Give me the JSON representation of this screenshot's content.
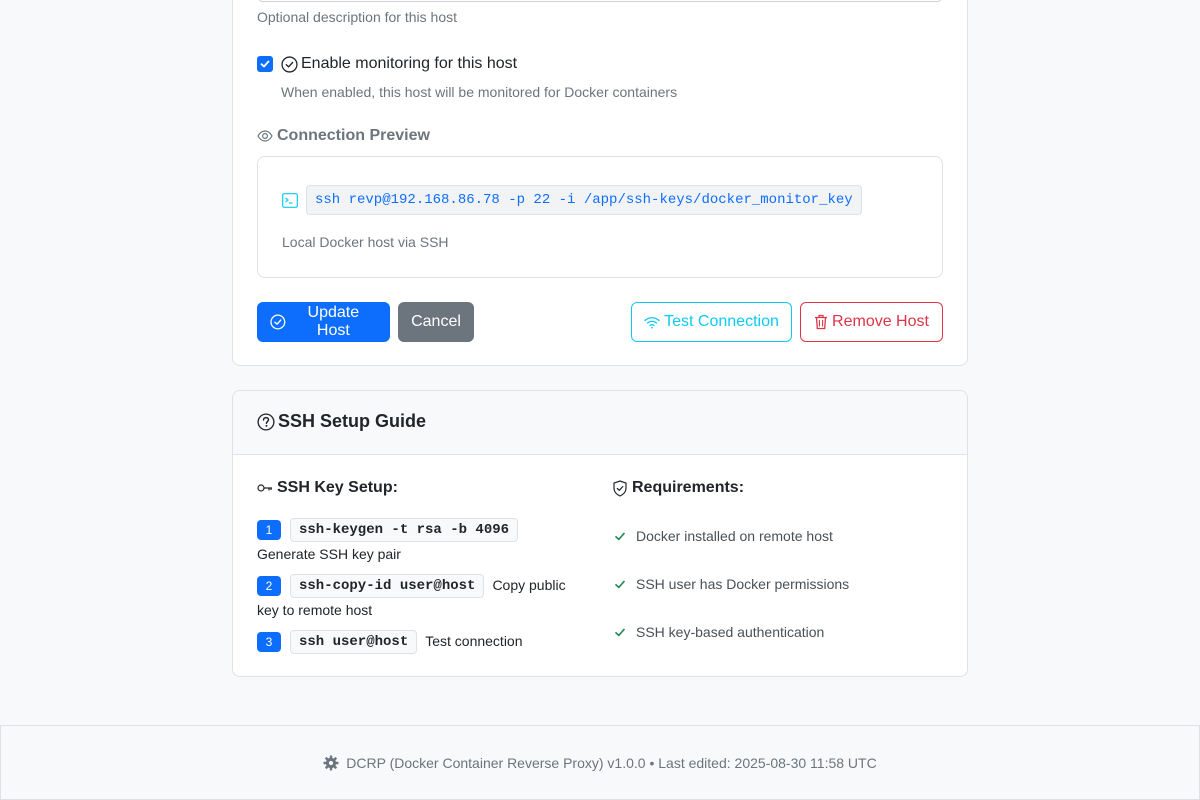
{
  "form": {
    "description_help": "Optional description for this host",
    "monitor_label": "Enable monitoring for this host",
    "monitor_checked": true,
    "monitor_help": "When enabled, this host will be monitored for Docker containers",
    "preview_title": "Connection Preview",
    "preview_command": "ssh revp@192.168.86.78 -p 22 -i /app/ssh-keys/docker_monitor_key",
    "preview_note": "Local Docker host via SSH",
    "buttons": {
      "update": "Update Host",
      "cancel": "Cancel",
      "test": "Test Connection",
      "remove": "Remove Host"
    }
  },
  "guide": {
    "title": "SSH Setup Guide",
    "key_setup_title": "SSH Key Setup:",
    "requirements_title": "Requirements:",
    "steps": [
      {
        "num": "1",
        "code": "ssh-keygen -t rsa -b 4096",
        "text": "Generate SSH key pair"
      },
      {
        "num": "2",
        "code": "ssh-copy-id user@host",
        "text": "Copy public key to remote host"
      },
      {
        "num": "3",
        "code": "ssh user@host",
        "text": "Test connection"
      }
    ],
    "requirements": [
      "Docker installed on remote host",
      "SSH user has Docker permissions",
      "SSH key-based authentication"
    ]
  },
  "footer": {
    "text": "DCRP (Docker Container Reverse Proxy) v1.0.0 • Last edited: 2025-08-30 11:58 UTC"
  },
  "colors": {
    "primary": "#0d6efd",
    "secondary": "#6c757d",
    "info": "#0dcaf0",
    "danger": "#dc3545",
    "success": "#198754"
  }
}
